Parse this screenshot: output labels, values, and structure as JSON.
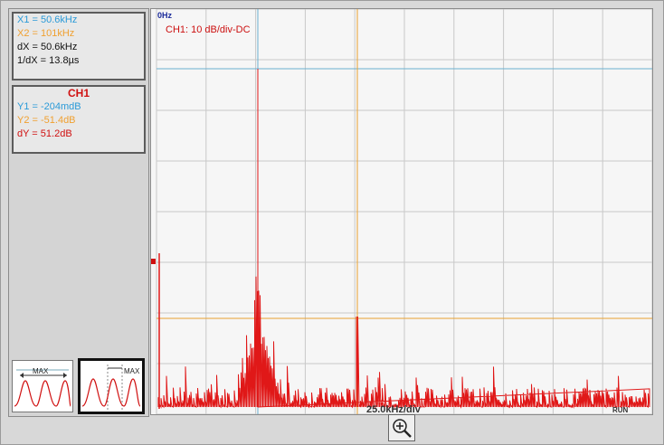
{
  "cursors": {
    "x1": "X1 = 50.6kHz",
    "x2": "X2 = 101kHz",
    "dx": "dX = 50.6kHz",
    "inv_dx": "1/dX = 13.8µs"
  },
  "channel": {
    "name": "CH1",
    "y1": "Y1 = -204mdB",
    "y2": "Y2 = -51.4dB",
    "dy": "dY = 51.2dB"
  },
  "plot": {
    "origin_label": "0Hz",
    "channel_scale": "CH1: 10 dB/div-DC",
    "x_scale": "25.0kHz/div",
    "run_status": "RUN"
  },
  "thumbnails": [
    {
      "label": "MAX"
    },
    {
      "label": "MAX"
    }
  ],
  "colors": {
    "x1": "#2a9ad8",
    "x2": "#f0a030",
    "trace": "#e01818",
    "grid": "#c8c8c8",
    "y1_line": "#6ab0d0",
    "y2_line": "#e8a030"
  },
  "icons": {
    "zoom": "zoom-in-icon"
  }
}
